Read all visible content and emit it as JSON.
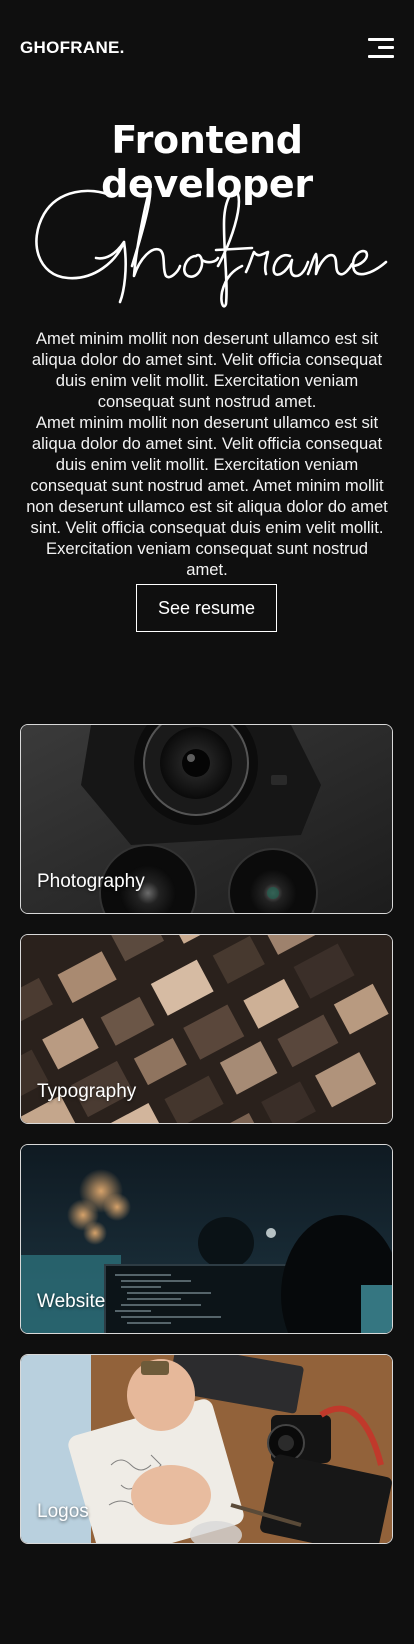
{
  "header": {
    "logo": "GHOFRANE.",
    "menu_icon": "hamburger-menu-icon"
  },
  "hero": {
    "title": "Frontend developer",
    "script_name": "Ghofrane",
    "paragraph_1": "Amet minim mollit non deserunt ullamco est sit aliqua dolor do amet sint. Velit officia consequat duis enim velit mollit. Exercitation veniam consequat sunt nostrud amet.",
    "paragraph_2": "Amet minim mollit non deserunt ullamco est sit aliqua dolor do amet sint. Velit officia consequat duis enim velit mollit. Exercitation veniam consequat sunt nostrud amet. Amet minim mollit non deserunt ullamco est sit aliqua dolor do amet sint. Velit officia consequat duis enim velit mollit. Exercitation veniam consequat sunt nostrud amet.",
    "resume_button": "See resume"
  },
  "categories": [
    {
      "label": "Photography"
    },
    {
      "label": "Typography"
    },
    {
      "label": "Website"
    },
    {
      "label": "Logos"
    }
  ],
  "colors": {
    "background": "#0f0f0f",
    "text": "#ffffff",
    "card_border": "#d9d9d9"
  }
}
